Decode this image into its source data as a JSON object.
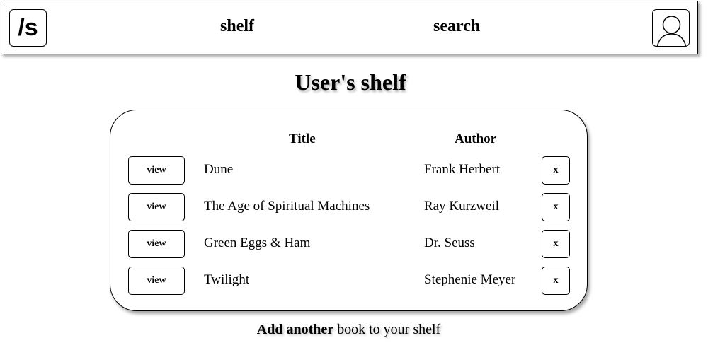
{
  "header": {
    "logo": "/s",
    "nav": {
      "shelf": "shelf",
      "search": "search"
    },
    "avatar_icon": "user-avatar-icon"
  },
  "page": {
    "title": "User's shelf"
  },
  "shelf": {
    "columns": {
      "title": "Title",
      "author": "Author"
    },
    "view_label": "view",
    "remove_label": "x",
    "books": [
      {
        "title": "Dune",
        "author": "Frank Herbert"
      },
      {
        "title": "The Age of Spiritual Machines",
        "author": "Ray Kurzweil"
      },
      {
        "title": "Green Eggs & Ham",
        "author": "Dr. Seuss"
      },
      {
        "title": "Twilight",
        "author": "Stephenie Meyer"
      }
    ]
  },
  "footer": {
    "add_bold": "Add another",
    "add_rest": " book to your shelf"
  }
}
